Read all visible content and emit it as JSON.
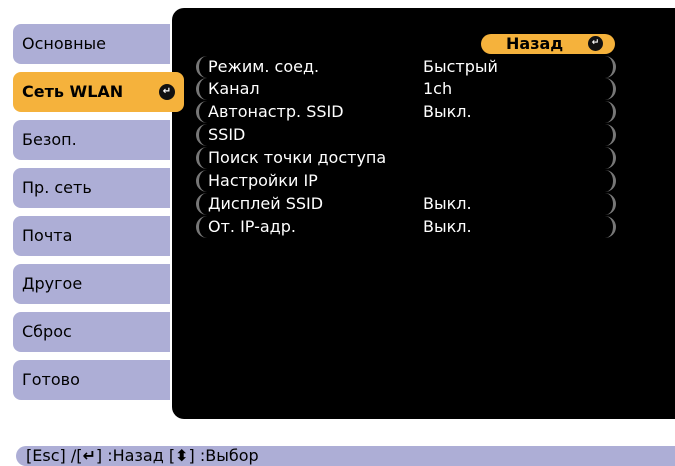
{
  "tabs": [
    {
      "label": "Основные"
    },
    {
      "label": "Сеть WLAN",
      "active": true
    },
    {
      "label": "Безоп."
    },
    {
      "label": "Пр. сеть"
    },
    {
      "label": "Почта"
    },
    {
      "label": "Другое"
    },
    {
      "label": "Сброс"
    },
    {
      "label": "Готово"
    }
  ],
  "back_label": "Назад",
  "rows": [
    {
      "label": "Режим. соед.",
      "value": "Быстрый"
    },
    {
      "label": "Канал",
      "value": "1ch"
    },
    {
      "label": "Автонастр. SSID",
      "value": "Выкл."
    },
    {
      "label": "SSID",
      "value": ""
    },
    {
      "label": "Поиск точки доступа",
      "value": ""
    },
    {
      "label": "Настройки IP",
      "value": ""
    },
    {
      "label": "Дисплей SSID",
      "value": "Выкл."
    },
    {
      "label": "От. IP-адр.",
      "value": "Выкл."
    }
  ],
  "help": {
    "part1": "[Esc] /[",
    "part2": "] :Назад  [",
    "part3": "] :Выбор",
    "enter_icon": "enter-icon",
    "updown_icon": "up-down-icon"
  }
}
